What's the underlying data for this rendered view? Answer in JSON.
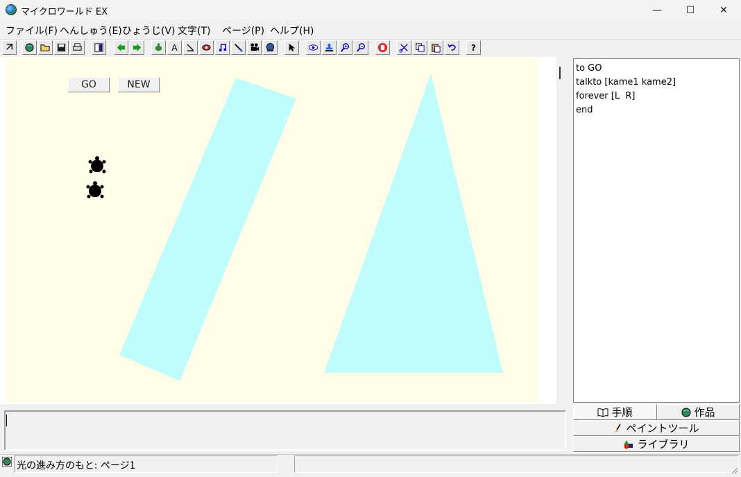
{
  "window": {
    "title": "マイクロワールド EX",
    "minimize_glyph": "—",
    "maximize_glyph": "☐",
    "close_glyph": "✕"
  },
  "menu": {
    "items": [
      {
        "label": "ファイル(F)"
      },
      {
        "label": "へんしゅう(E)"
      },
      {
        "label": "ひょうじ(V)"
      },
      {
        "label": "文字(T)"
      },
      {
        "label": "ページ(P)"
      },
      {
        "label": "ヘルプ(H)"
      }
    ]
  },
  "toolbar": {
    "help_glyph": "?",
    "text_tool_glyph": "A",
    "icons": [
      "arrow-icon",
      "globe-icon",
      "open-folder-icon",
      "save-icon",
      "print-icon",
      "page-layout-icon",
      "back-arrow-icon",
      "forward-arrow-icon",
      "turtle-icon",
      "text-box-icon",
      "pen-icon",
      "eye-pill-icon",
      "music-note-icon",
      "paint-brush-icon",
      "movie-camera-icon",
      "globe-record-icon",
      "pointer-icon",
      "eye-icon",
      "stamp-icon",
      "zoom-in-icon",
      "zoom-out-icon",
      "stop-hand-icon",
      "scissors-icon",
      "copy-icon",
      "paste-icon",
      "undo-icon",
      "help-icon"
    ]
  },
  "canvas": {
    "background": "#fffde8",
    "shape_color": "#c0fcfc",
    "buttons": [
      {
        "label": "GO"
      },
      {
        "label": "NEW"
      }
    ],
    "turtles": [
      {
        "name": "kame1"
      },
      {
        "name": "kame2"
      }
    ]
  },
  "procedures": {
    "lines": [
      "to GO",
      "talkto [kame1 kame2]",
      "forever [L  R]",
      "end"
    ]
  },
  "tabs": {
    "procedures": "手順",
    "project": "作品",
    "paint_tools": "ペイントツール",
    "library": "ライブラリ"
  },
  "command_center": {
    "value": ""
  },
  "status": {
    "text": "光の進み方のもと: ページ1"
  }
}
